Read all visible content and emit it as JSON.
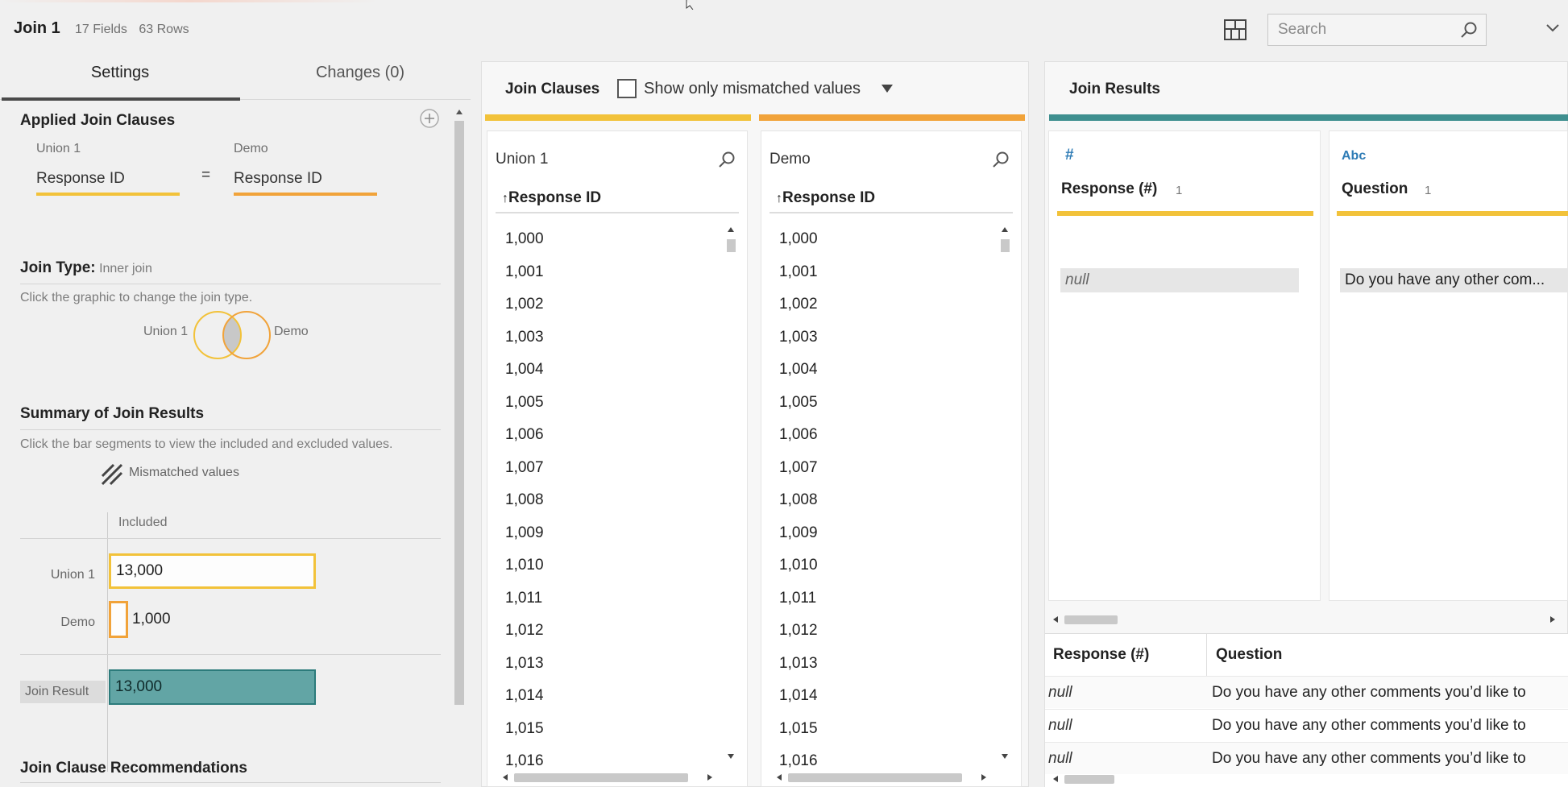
{
  "header": {
    "step_name": "Join 1",
    "fields_count": "17 Fields",
    "rows_count": "63 Rows",
    "search_placeholder": "Search"
  },
  "tabs": {
    "settings": "Settings",
    "changes": "Changes (0)"
  },
  "applied_clauses": {
    "title": "Applied Join Clauses",
    "left_source": "Union 1",
    "right_source": "Demo",
    "left_field": "Response ID",
    "operator": "=",
    "right_field": "Response ID"
  },
  "join_type": {
    "label": "Join Type:",
    "value": "Inner join",
    "hint": "Click the graphic to change the join type.",
    "venn_left": "Union 1",
    "venn_right": "Demo"
  },
  "summary": {
    "title": "Summary of Join Results",
    "hint": "Click the bar segments to view the included and excluded values.",
    "legend_mismatched": "Mismatched values",
    "col_included": "Included",
    "rows": [
      {
        "label": "Union 1",
        "value": "13,000"
      },
      {
        "label": "Demo",
        "value": "1,000"
      },
      {
        "label": "Join Result",
        "value": "13,000"
      }
    ]
  },
  "recommendations": {
    "title": "Join Clause Recommendations"
  },
  "join_clauses": {
    "title": "Join Clauses",
    "show_mismatched": "Show only mismatched values",
    "left": {
      "source": "Union 1",
      "field": "Response ID",
      "values": [
        "1,000",
        "1,001",
        "1,002",
        "1,003",
        "1,004",
        "1,005",
        "1,006",
        "1,007",
        "1,008",
        "1,009",
        "1,010",
        "1,011",
        "1,012",
        "1,013",
        "1,014",
        "1,015",
        "1,016"
      ]
    },
    "right": {
      "source": "Demo",
      "field": "Response ID",
      "values": [
        "1,000",
        "1,001",
        "1,002",
        "1,003",
        "1,004",
        "1,005",
        "1,006",
        "1,007",
        "1,008",
        "1,009",
        "1,010",
        "1,011",
        "1,012",
        "1,013",
        "1,014",
        "1,015",
        "1,016"
      ]
    }
  },
  "join_results": {
    "title": "Join Results",
    "profile": [
      {
        "type_icon": "#",
        "field": "Response (#)",
        "count": "1",
        "value": "null"
      },
      {
        "type_icon": "Abc",
        "field": "Question",
        "count": "1",
        "value": "Do you have any other com..."
      }
    ],
    "grid": {
      "headers": [
        "Response (#)",
        "Question"
      ],
      "rows": [
        [
          "null",
          "Do you have any other comments you’d like to"
        ],
        [
          "null",
          "Do you have any other comments you’d like to"
        ],
        [
          "null",
          "Do you have any other comments you’d like to"
        ]
      ]
    }
  },
  "colors": {
    "union_yellow": "#f2c23a",
    "demo_orange": "#f1a33a",
    "result_teal": "#3f8f8f"
  }
}
